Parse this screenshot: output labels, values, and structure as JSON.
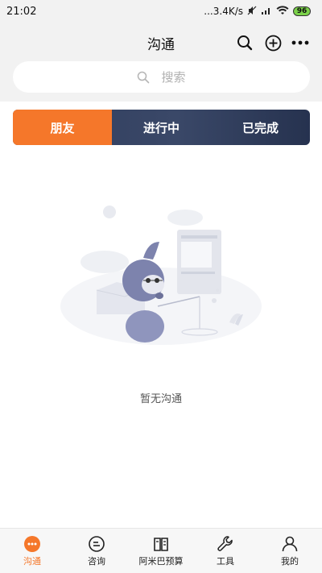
{
  "status_bar": {
    "time": "21:02",
    "network": "...3.4K/s",
    "battery": "96"
  },
  "header": {
    "title": "沟通"
  },
  "search": {
    "placeholder": "搜索"
  },
  "tabs": [
    {
      "label": "朋友",
      "active": true
    },
    {
      "label": "进行中",
      "active": false
    },
    {
      "label": "已完成",
      "active": false
    }
  ],
  "empty_state": {
    "text": "暂无沟通"
  },
  "bottom_nav": [
    {
      "label": "沟通",
      "icon": "chat-dots-icon",
      "active": true
    },
    {
      "label": "咨询",
      "icon": "consult-icon",
      "active": false
    },
    {
      "label": "阿米巴预算",
      "icon": "book-icon",
      "active": false
    },
    {
      "label": "工具",
      "icon": "wrench-icon",
      "active": false
    },
    {
      "label": "我的",
      "icon": "user-icon",
      "active": false
    }
  ],
  "colors": {
    "accent": "#f5772a",
    "tab_bg": "#2f3c5c",
    "header_bg": "#f2f2f2"
  }
}
